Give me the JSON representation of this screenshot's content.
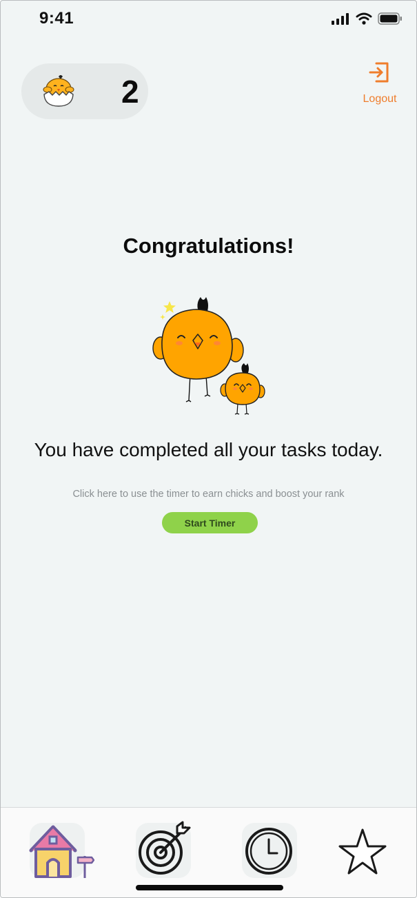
{
  "status_bar": {
    "time": "9:41"
  },
  "header": {
    "chick_count": "2",
    "logout_label": "Logout"
  },
  "main": {
    "title": "Congratulations!",
    "message": "You have completed all your tasks today.",
    "hint": "Click here to use the timer to earn chicks and boost your rank",
    "start_timer_label": "Start Timer"
  },
  "tabs": [
    {
      "id": "home",
      "icon": "home-icon",
      "selected": true
    },
    {
      "id": "goals",
      "icon": "target-icon"
    },
    {
      "id": "timer",
      "icon": "clock-icon"
    },
    {
      "id": "ranking",
      "icon": "star-icon"
    }
  ],
  "colors": {
    "accent_orange": "#ef7d2c",
    "chick_orange": "#ffa400",
    "button_green": "#8fd24a",
    "background": "#f1f5f5"
  }
}
